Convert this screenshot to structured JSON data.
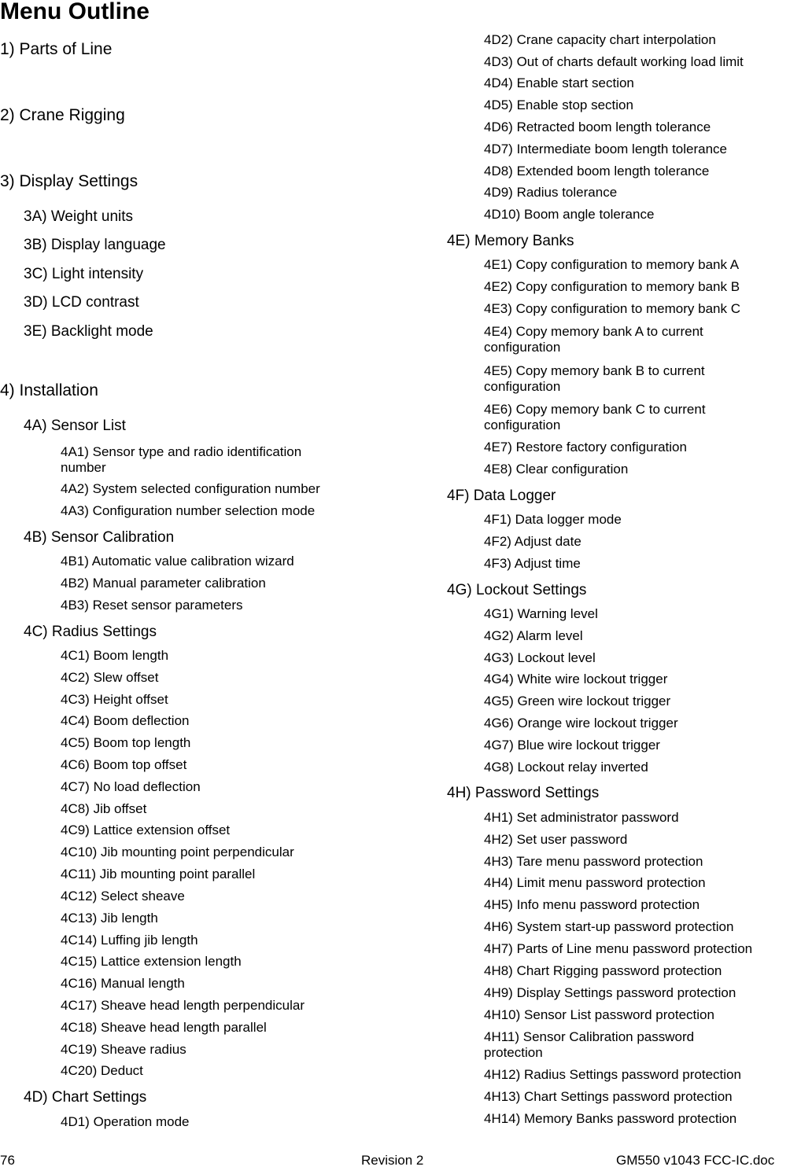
{
  "document": {
    "title": "Menu Outline",
    "left_column": [
      {
        "level": 1,
        "text": "1) Parts of Line"
      },
      {
        "level": 1,
        "text": "2) Crane Rigging"
      },
      {
        "level": 1,
        "text": "3) Display Settings"
      },
      {
        "level": 2,
        "text": "3A) Weight units"
      },
      {
        "level": 2,
        "text": "3B) Display language"
      },
      {
        "level": 2,
        "text": "3C) Light intensity"
      },
      {
        "level": 2,
        "text": "3D) LCD contrast"
      },
      {
        "level": 2,
        "text": "3E) Backlight mode"
      },
      {
        "level": 1,
        "text": "4) Installation"
      },
      {
        "level": 2,
        "text": "4A) Sensor List"
      },
      {
        "level": 3,
        "text": "4A1) Sensor type and radio identification number"
      },
      {
        "level": 3,
        "text": "4A2) System selected configuration number"
      },
      {
        "level": 3,
        "text": "4A3) Configuration number selection mode"
      },
      {
        "level": 2,
        "text": "4B) Sensor Calibration"
      },
      {
        "level": 3,
        "text": "4B1) Automatic value calibration wizard"
      },
      {
        "level": 3,
        "text": "4B2) Manual parameter calibration"
      },
      {
        "level": 3,
        "text": "4B3) Reset sensor parameters"
      },
      {
        "level": 2,
        "text": "4C) Radius Settings"
      },
      {
        "level": 3,
        "text": "4C1) Boom length"
      },
      {
        "level": 3,
        "text": "4C2) Slew offset"
      },
      {
        "level": 3,
        "text": "4C3) Height offset"
      },
      {
        "level": 3,
        "text": "4C4) Boom deflection"
      },
      {
        "level": 3,
        "text": "4C5) Boom top length"
      },
      {
        "level": 3,
        "text": "4C6) Boom top offset"
      },
      {
        "level": 3,
        "text": "4C7) No load deflection"
      },
      {
        "level": 3,
        "text": "4C8) Jib offset"
      },
      {
        "level": 3,
        "text": "4C9) Lattice extension offset"
      },
      {
        "level": 3,
        "text": "4C10) Jib mounting point perpendicular"
      },
      {
        "level": 3,
        "text": "4C11) Jib mounting point parallel"
      },
      {
        "level": 3,
        "text": "4C12) Select sheave"
      },
      {
        "level": 3,
        "text": "4C13) Jib length"
      },
      {
        "level": 3,
        "text": "4C14) Luffing jib length"
      },
      {
        "level": 3,
        "text": "4C15) Lattice extension length"
      },
      {
        "level": 3,
        "text": "4C16) Manual length"
      },
      {
        "level": 3,
        "text": "4C17) Sheave head length perpendicular"
      },
      {
        "level": 3,
        "text": "4C18) Sheave head length parallel"
      },
      {
        "level": 3,
        "text": "4C19) Sheave radius"
      },
      {
        "level": 3,
        "text": "4C20) Deduct"
      },
      {
        "level": 2,
        "text": "4D) Chart Settings"
      },
      {
        "level": 3,
        "text": "4D1) Operation mode"
      }
    ],
    "right_column": [
      {
        "level": 3,
        "text": "4D2) Crane capacity chart interpolation"
      },
      {
        "level": 3,
        "text": "4D3) Out of charts default working load limit"
      },
      {
        "level": 3,
        "text": "4D4) Enable start section"
      },
      {
        "level": 3,
        "text": "4D5) Enable stop section"
      },
      {
        "level": 3,
        "text": "4D6) Retracted boom length tolerance"
      },
      {
        "level": 3,
        "text": "4D7) Intermediate boom length tolerance"
      },
      {
        "level": 3,
        "text": "4D8) Extended boom length tolerance"
      },
      {
        "level": 3,
        "text": "4D9) Radius tolerance"
      },
      {
        "level": 3,
        "text": "4D10) Boom angle tolerance"
      },
      {
        "level": 2,
        "text": "4E) Memory Banks"
      },
      {
        "level": 3,
        "text": "4E1) Copy configuration to memory bank A"
      },
      {
        "level": 3,
        "text": "4E2) Copy configuration to memory bank B"
      },
      {
        "level": 3,
        "text": "4E3) Copy configuration to memory bank C"
      },
      {
        "level": 3,
        "text": "4E4) Copy memory bank A to current configuration"
      },
      {
        "level": 3,
        "text": "4E5) Copy memory bank B to current configuration"
      },
      {
        "level": 3,
        "text": "4E6) Copy memory bank C to current configuration"
      },
      {
        "level": 3,
        "text": "4E7) Restore factory configuration"
      },
      {
        "level": 3,
        "text": "4E8) Clear configuration"
      },
      {
        "level": 2,
        "text": "4F) Data Logger"
      },
      {
        "level": 3,
        "text": "4F1) Data logger mode"
      },
      {
        "level": 3,
        "text": "4F2) Adjust date"
      },
      {
        "level": 3,
        "text": "4F3) Adjust time"
      },
      {
        "level": 2,
        "text": "4G) Lockout Settings"
      },
      {
        "level": 3,
        "text": "4G1) Warning level"
      },
      {
        "level": 3,
        "text": "4G2) Alarm level"
      },
      {
        "level": 3,
        "text": "4G3) Lockout level"
      },
      {
        "level": 3,
        "text": "4G4) White wire lockout trigger"
      },
      {
        "level": 3,
        "text": "4G5) Green wire lockout trigger"
      },
      {
        "level": 3,
        "text": "4G6) Orange wire lockout trigger"
      },
      {
        "level": 3,
        "text": "4G7) Blue wire lockout trigger"
      },
      {
        "level": 3,
        "text": "4G8) Lockout relay inverted"
      },
      {
        "level": 2,
        "text": "4H) Password Settings"
      },
      {
        "level": 3,
        "text": "4H1) Set administrator password"
      },
      {
        "level": 3,
        "text": "4H2) Set user password"
      },
      {
        "level": 3,
        "text": "4H3) Tare menu password protection"
      },
      {
        "level": 3,
        "text": "4H4) Limit menu password protection"
      },
      {
        "level": 3,
        "text": "4H5) Info menu password protection"
      },
      {
        "level": 3,
        "text": "4H6) System start-up password protection"
      },
      {
        "level": 3,
        "text": "4H7) Parts of Line menu password protection"
      },
      {
        "level": 3,
        "text": "4H8) Chart Rigging password protection"
      },
      {
        "level": 3,
        "text": "4H9) Display Settings password protection"
      },
      {
        "level": 3,
        "text": "4H10) Sensor List password protection"
      },
      {
        "level": 3,
        "text": "4H11) Sensor Calibration password protection"
      },
      {
        "level": 3,
        "text": "4H12) Radius Settings password protection"
      },
      {
        "level": 3,
        "text": "4H13) Chart Settings password protection"
      },
      {
        "level": 3,
        "text": "4H14) Memory Banks password protection"
      }
    ]
  },
  "footer": {
    "page_number": "76",
    "revision": "Revision 2",
    "filename": "GM550 v1043 FCC-IC.doc"
  }
}
